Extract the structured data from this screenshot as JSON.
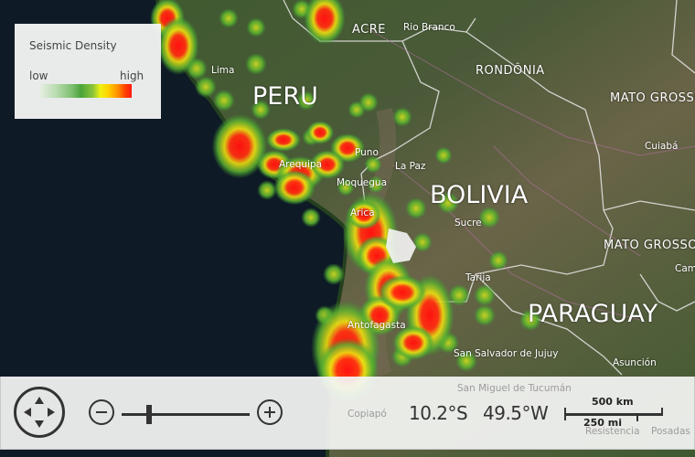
{
  "map": {
    "imagery": "satellite",
    "countries": [
      "PERU",
      "BOLIVIA",
      "PARAGUAY"
    ],
    "states": [
      "ACRE",
      "RONDÔNIA",
      "MATO GROSSO",
      "MATO GROSSO"
    ],
    "cities": [
      "Rio Branco",
      "Lima",
      "Cuiabá",
      "Puno",
      "La Paz",
      "Arequipa",
      "Moquegua",
      "Arica",
      "Sucre",
      "Tarija",
      "Antofagasta",
      "San Salvador de Jujuy",
      "Asunción",
      "Campo Grande",
      "Copiapó",
      "Resistencia",
      "Posadas",
      "San Miguel de Tucumán"
    ],
    "colors": {
      "ocean": "#0e1a26",
      "land": "#3f5230",
      "heat_high": "#ff1a10",
      "heat_mid": "#f0f010",
      "heat_low": "#4aa43a"
    }
  },
  "legend": {
    "title": "Seismic Density",
    "low_label": "low",
    "high_label": "high",
    "gradient_colors": [
      "#e8eee4",
      "#b9dcb0",
      "#7fc070",
      "#4aa43a",
      "#8cc43a",
      "#f0f010",
      "#ffd000",
      "#ff9000",
      "#ff4000",
      "#ff1a10"
    ]
  },
  "controls": {
    "pan_icon": "directional-pad-icon",
    "zoom_out_icon": "minus-circle-icon",
    "zoom_in_icon": "plus-circle-icon",
    "zoom_level_fraction": 0.2,
    "latitude": "10.2°S",
    "longitude": "49.5°W",
    "scale_km": "500 km",
    "scale_mi": "250 mi"
  }
}
